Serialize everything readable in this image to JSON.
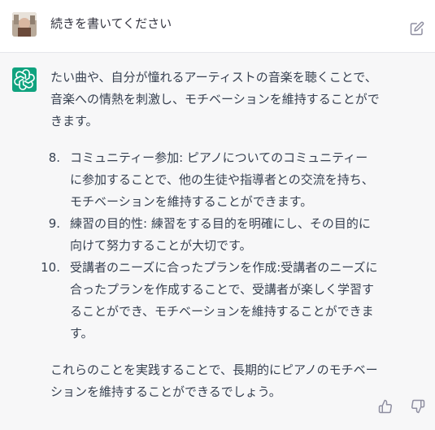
{
  "user_message": {
    "text": "続きを書いてください"
  },
  "assistant_message": {
    "intro": "たい曲や、自分が憧れるアーティストの音楽を聴くことで、音楽への情熱を刺激し、モチベーションを維持することができます。",
    "items": [
      {
        "number": "8.",
        "text": "コミュニティー参加: ピアノについてのコミュニティーに参加することで、他の生徒や指導者との交流を持ち、モチベーションを維持することができます。"
      },
      {
        "number": "9.",
        "text": "練習の目的性: 練習をする目的を明確にし、その目的に向けて努力することが大切です。"
      },
      {
        "number": "10.",
        "text": "受講者のニーズに合ったプランを作成:受講者のニーズに合ったプランを作成することで、受講者が楽しく学習することができ、モチベーションを維持することができます。"
      }
    ],
    "conclusion": "これらのことを実践することで、長期的にピアノのモチベーションを維持することができるでしょう。"
  },
  "icons": {
    "edit": "edit-icon",
    "bot": "openai-logo-icon",
    "thumbs_up": "thumbs-up-icon",
    "thumbs_down": "thumbs-down-icon"
  },
  "colors": {
    "assistant_bg": "#f7f7f8",
    "bot_avatar": "#10a37f",
    "text": "#374151",
    "icon": "#8e8ea0"
  }
}
